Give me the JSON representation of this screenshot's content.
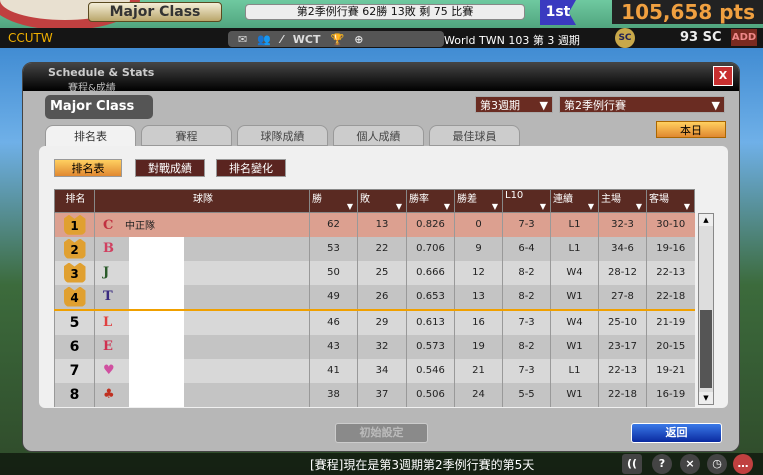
{
  "top": {
    "class": "Major Class",
    "season_info": "第2季例行賽  62勝 13敗   剩 75 比賽",
    "rank_flag": "1st",
    "points": "105,658 pts",
    "user": "CCUTW",
    "tools": [
      "WCT"
    ],
    "week_text": "World TWN 103 第 3 週期",
    "sc_icon": "SC",
    "sc_value": "93 SC",
    "add": "ADD"
  },
  "dialog": {
    "title": "Schedule & Stats",
    "subtitle": "賽程&成績",
    "close": "X",
    "class_label": "Major Class",
    "week_select": "第3週期",
    "season_select": "第2季例行賽",
    "today": "本日",
    "tabs": [
      "排名表",
      "賽程",
      "球隊成績",
      "個人成績",
      "最佳球員"
    ],
    "subtabs": [
      "排名表",
      "對戰成績",
      "排名變化"
    ],
    "columns": [
      "排名",
      "球隊",
      "勝",
      "敗",
      "勝率",
      "勝差",
      "L10",
      "連續",
      "主場",
      "客場"
    ],
    "rows": [
      {
        "rank": "1",
        "logo": "C",
        "team": "中正隊",
        "w": "62",
        "l": "13",
        "pct": "0.826",
        "gb": "0",
        "l10": "7-3",
        "streak": "L1",
        "home": "32-3",
        "away": "30-10"
      },
      {
        "rank": "2",
        "logo": "B",
        "team": "",
        "w": "53",
        "l": "22",
        "pct": "0.706",
        "gb": "9",
        "l10": "6-4",
        "streak": "L1",
        "home": "34-6",
        "away": "19-16"
      },
      {
        "rank": "3",
        "logo": "J",
        "team": "",
        "w": "50",
        "l": "25",
        "pct": "0.666",
        "gb": "12",
        "l10": "8-2",
        "streak": "W4",
        "home": "28-12",
        "away": "22-13"
      },
      {
        "rank": "4",
        "logo": "T",
        "team": "",
        "w": "49",
        "l": "26",
        "pct": "0.653",
        "gb": "13",
        "l10": "8-2",
        "streak": "W1",
        "home": "27-8",
        "away": "22-18"
      },
      {
        "rank": "5",
        "logo": "L",
        "team": "",
        "w": "46",
        "l": "29",
        "pct": "0.613",
        "gb": "16",
        "l10": "7-3",
        "streak": "W4",
        "home": "25-10",
        "away": "21-19"
      },
      {
        "rank": "6",
        "logo": "E",
        "team": "",
        "w": "43",
        "l": "32",
        "pct": "0.573",
        "gb": "19",
        "l10": "8-2",
        "streak": "W1",
        "home": "23-17",
        "away": "20-15"
      },
      {
        "rank": "7",
        "logo": "♥",
        "team": "",
        "w": "41",
        "l": "34",
        "pct": "0.546",
        "gb": "21",
        "l10": "7-3",
        "streak": "L1",
        "home": "22-13",
        "away": "19-21"
      },
      {
        "rank": "8",
        "logo": "♣",
        "team": "",
        "w": "38",
        "l": "37",
        "pct": "0.506",
        "gb": "24",
        "l10": "5-5",
        "streak": "W1",
        "home": "22-18",
        "away": "16-19"
      }
    ],
    "init_button": "初始設定",
    "back_button": "返回"
  },
  "status": {
    "message": "[賽程]現在是第3週期第2季例行賽的第5天",
    "controls": [
      "((",
      "?",
      "×",
      "◷",
      "…"
    ]
  }
}
